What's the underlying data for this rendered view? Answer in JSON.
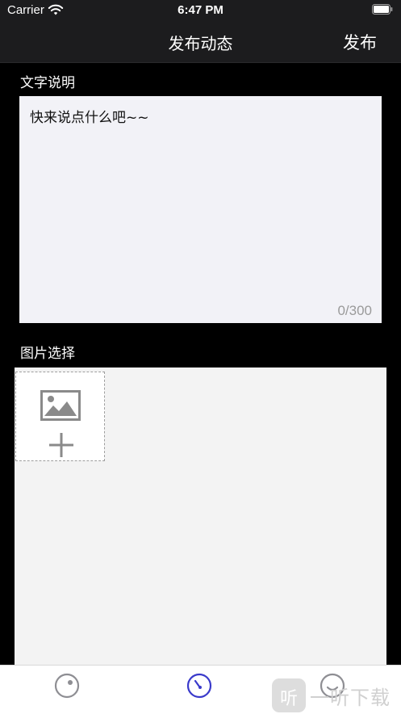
{
  "status_bar": {
    "carrier": "Carrier",
    "time": "6:47 PM",
    "wifi_icon": "wifi-icon",
    "battery_icon": "battery-icon"
  },
  "nav": {
    "title": "发布动态",
    "publish_label": "发布"
  },
  "text_section": {
    "label": "文字说明",
    "placeholder": "快来说点什么吧~~",
    "char_count": "0/300"
  },
  "image_section": {
    "label": "图片选择",
    "add_icon": "image-placeholder-icon",
    "plus_icon": "plus-icon"
  },
  "tab_bar": {
    "tabs": [
      {
        "icon": "discover-icon",
        "active": false
      },
      {
        "icon": "dashboard-icon",
        "active": true
      },
      {
        "icon": "smile-icon",
        "active": false
      }
    ]
  },
  "watermark": {
    "badge": "听",
    "text": "一听下载"
  },
  "colors": {
    "background": "#000000",
    "nav_background": "#1c1c1e",
    "text_box": "#f2f2f7",
    "image_area": "#f3f3f3",
    "tab_active": "#3a3acb",
    "tab_inactive": "#8e8e93"
  }
}
